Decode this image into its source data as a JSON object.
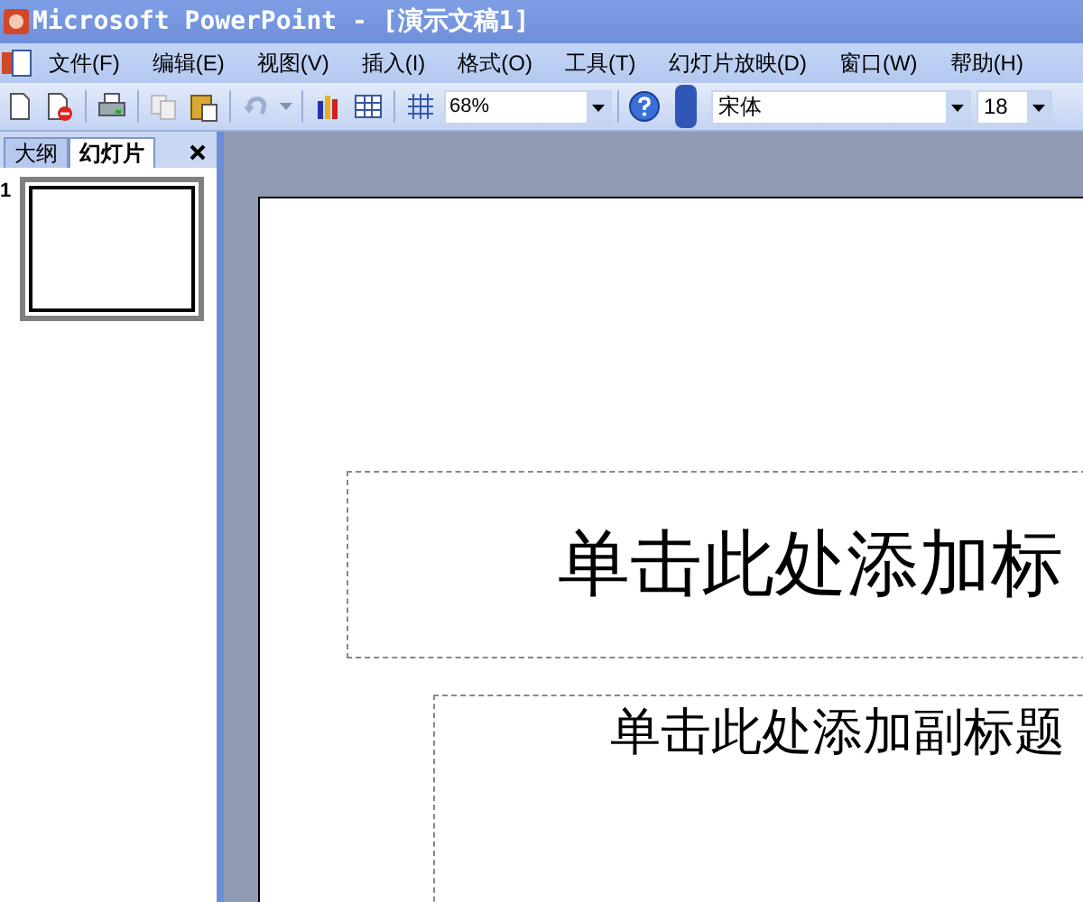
{
  "window": {
    "title": "Microsoft PowerPoint - [演示文稿1]"
  },
  "menu": [
    "文件(F)",
    "编辑(E)",
    "视图(V)",
    "插入(I)",
    "格式(O)",
    "工具(T)",
    "幻灯片放映(D)",
    "窗口(W)",
    "帮助(H)"
  ],
  "toolbar": {
    "zoom": "68%",
    "font": "宋体",
    "font_size": "18"
  },
  "pane_tabs": [
    {
      "label": "大纲",
      "selected": false
    },
    {
      "label": "幻灯片",
      "selected": true
    }
  ],
  "slides": [
    {
      "number": "1",
      "selected": true
    }
  ],
  "slide": {
    "title_placeholder": "单击此处添加标",
    "subtitle_placeholder": "单击此处添加副标题"
  }
}
